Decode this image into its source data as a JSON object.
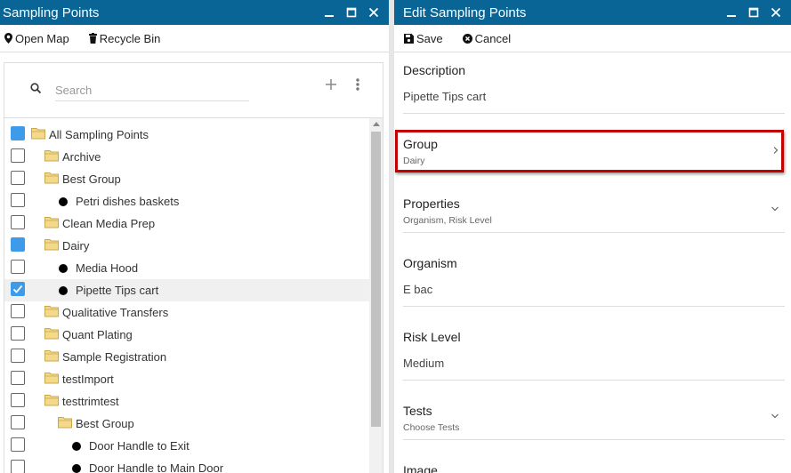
{
  "left_panel": {
    "title": "Sampling Points",
    "toolbar": {
      "open_map": "Open Map",
      "recycle_bin": "Recycle Bin"
    },
    "search": {
      "placeholder": "Search",
      "value": ""
    },
    "tree": [
      {
        "label": "All Sampling Points",
        "type": "folder",
        "depth": 0,
        "check": "filled",
        "selected": false
      },
      {
        "label": "Archive",
        "type": "folder",
        "depth": 1,
        "check": "empty",
        "selected": false
      },
      {
        "label": "Best Group",
        "type": "folder",
        "depth": 1,
        "check": "empty",
        "selected": false
      },
      {
        "label": "Petri dishes baskets",
        "type": "point",
        "depth": 2,
        "check": "empty",
        "selected": false
      },
      {
        "label": "Clean Media Prep",
        "type": "folder",
        "depth": 1,
        "check": "empty",
        "selected": false
      },
      {
        "label": "Dairy",
        "type": "folder",
        "depth": 1,
        "check": "filled",
        "selected": false
      },
      {
        "label": "Media Hood",
        "type": "point",
        "depth": 2,
        "check": "empty",
        "selected": false
      },
      {
        "label": "Pipette Tips cart",
        "type": "point",
        "depth": 2,
        "check": "checked",
        "selected": true
      },
      {
        "label": "Qualitative Transfers",
        "type": "folder",
        "depth": 1,
        "check": "empty",
        "selected": false
      },
      {
        "label": "Quant Plating",
        "type": "folder",
        "depth": 1,
        "check": "empty",
        "selected": false
      },
      {
        "label": "Sample Registration",
        "type": "folder",
        "depth": 1,
        "check": "empty",
        "selected": false
      },
      {
        "label": "testImport",
        "type": "folder",
        "depth": 1,
        "check": "empty",
        "selected": false
      },
      {
        "label": "testtrimtest",
        "type": "folder",
        "depth": 1,
        "check": "empty",
        "selected": false
      },
      {
        "label": "Best Group",
        "type": "folder",
        "depth": 2,
        "check": "empty",
        "selected": false
      },
      {
        "label": "Door Handle to Exit",
        "type": "point",
        "depth": 3,
        "check": "empty",
        "selected": false
      },
      {
        "label": "Door Handle to Main Door",
        "type": "point",
        "depth": 3,
        "check": "empty",
        "selected": false
      }
    ]
  },
  "right_panel": {
    "title": "Edit Sampling Points",
    "toolbar": {
      "save": "Save",
      "cancel": "Cancel"
    },
    "fields": {
      "description": {
        "label": "Description",
        "value": "Pipette Tips cart"
      },
      "group": {
        "label": "Group",
        "value": "Dairy"
      },
      "properties": {
        "label": "Properties",
        "value": "Organism, Risk Level"
      },
      "organism": {
        "label": "Organism",
        "value": "E bac"
      },
      "risk_level": {
        "label": "Risk Level",
        "value": "Medium"
      },
      "tests": {
        "label": "Tests",
        "value": "Choose Tests"
      },
      "image": {
        "label": "Image"
      }
    }
  },
  "colors": {
    "titlebar": "#086596",
    "checkbox_accent": "#3d9be9",
    "highlight": "#c20000",
    "folder": "#f5d98b"
  }
}
